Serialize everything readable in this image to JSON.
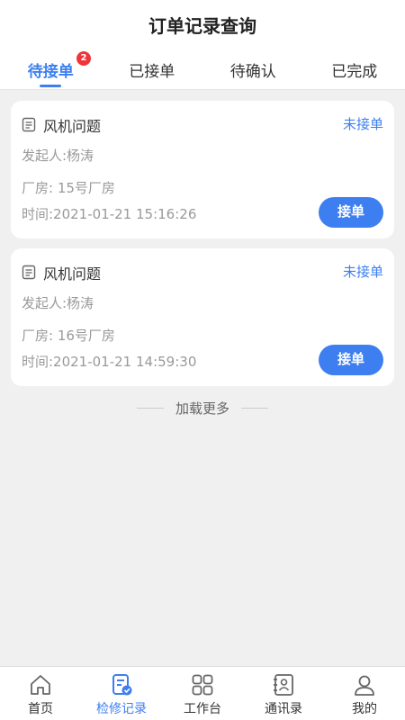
{
  "header": {
    "title": "订单记录查询"
  },
  "tabs": [
    {
      "label": "待接单",
      "badge": "2",
      "active": true
    },
    {
      "label": "已接单"
    },
    {
      "label": "待确认"
    },
    {
      "label": "已完成"
    }
  ],
  "orders": [
    {
      "type": "风机问题",
      "status": "未接单",
      "initiator": "发起人:杨涛",
      "plant": "厂房: 15号厂房",
      "time": "时间:2021-01-21 15:16:26",
      "action": "接单"
    },
    {
      "type": "风机问题",
      "status": "未接单",
      "initiator": "发起人:杨涛",
      "plant": "厂房: 16号厂房",
      "time": "时间:2021-01-21 14:59:30",
      "action": "接单"
    }
  ],
  "load_more": "加载更多",
  "tabbar": [
    {
      "label": "首页",
      "icon": "home-icon"
    },
    {
      "label": "检修记录",
      "icon": "record-icon",
      "active": true
    },
    {
      "label": "工作台",
      "icon": "grid-icon"
    },
    {
      "label": "通讯录",
      "icon": "contacts-icon"
    },
    {
      "label": "我的",
      "icon": "user-icon"
    }
  ],
  "colors": {
    "accent": "#3d7ff0",
    "badge": "#f0353a",
    "background": "#f0f0f0"
  }
}
